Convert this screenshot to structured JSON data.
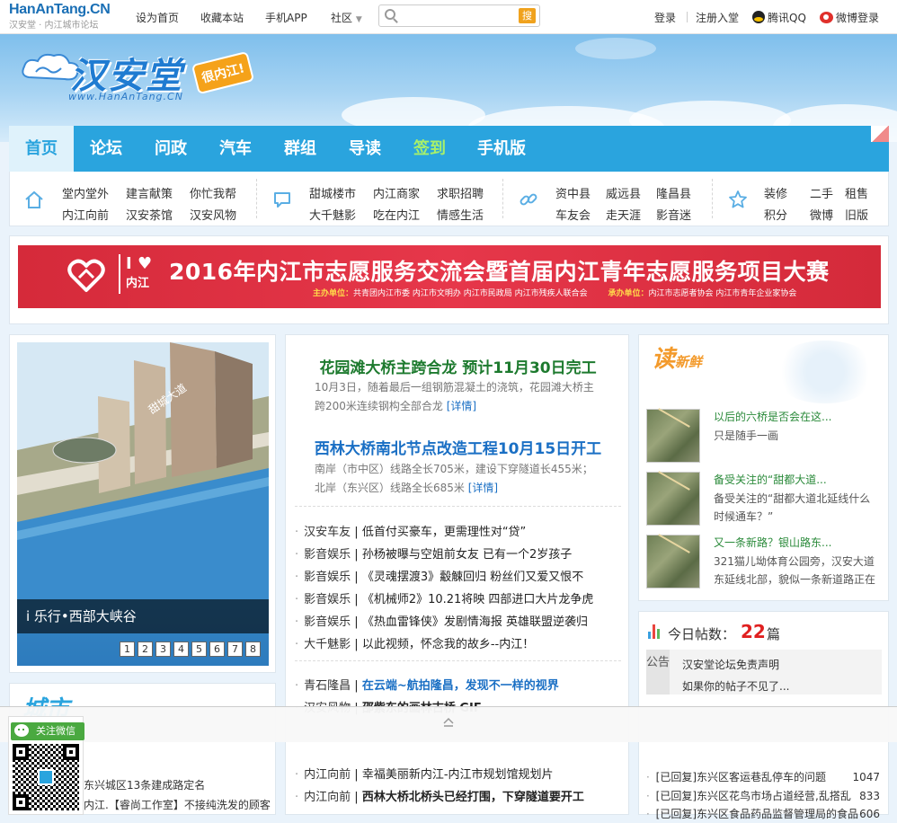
{
  "topbar": {
    "logo_text": "HanAnTang.CN",
    "logo_sub": "汉安堂 · 内江城市论坛",
    "links": [
      "设为首页",
      "收藏本站",
      "手机APP",
      "社区"
    ],
    "search": {
      "placeholder": "",
      "button": "搜"
    },
    "login": "登录",
    "register": "注册入堂",
    "qq": "腾讯QQ",
    "weibo": "微博登录"
  },
  "logo": {
    "name": "汉安堂",
    "slogan": "很内江!",
    "url": "www.HanAnTang.CN"
  },
  "nav": {
    "items": [
      "首页",
      "论坛",
      "问政",
      "汽车",
      "群组",
      "导读",
      "签到",
      "手机版"
    ]
  },
  "subnav": {
    "group1": [
      "堂内堂外",
      "建言献策",
      "你忙我帮",
      "内江向前",
      "汉安茶馆",
      "汉安风物"
    ],
    "group2": [
      "甜城楼市",
      "内江商家",
      "求职招聘",
      "大千魅影",
      "吃在内江",
      "情感生活"
    ],
    "group3": [
      "资中县",
      "威远县",
      "隆昌县",
      "车友会",
      "走天涯",
      "影音迷"
    ],
    "group4": [
      "装修",
      "二手",
      "租售",
      "积分",
      "微博",
      "旧版"
    ]
  },
  "ad": {
    "i_love": "I ♥",
    "city": "内江",
    "title": "2016年内江市志愿服务交流会暨首届内江青年志愿服务项目大赛",
    "host_label": "主办单位：",
    "host": "共青团内江市委  内江市文明办  内江市民政局  内江市残疾人联合会",
    "organizer_label": "承办单位：",
    "organizer": "内江市志愿者协会  内江市青年企业家协会"
  },
  "slider": {
    "caption": "i 乐行•西部大峡谷",
    "pages": [
      "1",
      "2",
      "3",
      "4",
      "5",
      "6",
      "7",
      "8"
    ]
  },
  "headlines": [
    {
      "title": "花园滩大桥主跨合龙 预计11月30日完工",
      "summary": "10月3日，随着最后一组钢筋混凝土的浇筑，花园滩大桥主跨200米连续钢构全部合龙",
      "more": "[详情]"
    },
    {
      "title": "西林大桥南北节点改造工程10月15日开工",
      "summary": "南岸（市中区）线路全长705米，建设下穿隧道长455米；北岸（东兴区）线路全长685米",
      "more": "[详情]"
    }
  ],
  "news1": [
    {
      "cat": "汉安车友",
      "text": "低首付买豪车，更需理性对“贷”"
    },
    {
      "cat": "影音娱乐",
      "text": "孙杨被曝与空姐前女友 已有一个2岁孩子"
    },
    {
      "cat": "影音娱乐",
      "text": "《灵魂摆渡3》觳觫回归 粉丝们又爱又恨不"
    },
    {
      "cat": "影音娱乐",
      "text": "《机械师2》10.21将映 四部进口大片龙争虎"
    },
    {
      "cat": "影音娱乐",
      "text": "《热血雷锋侠》发剧情海报 英雄联盟逆袭归"
    },
    {
      "cat": "大千魅影",
      "text": "以此视频，怀念我的故乡--内江！"
    }
  ],
  "news2": [
    {
      "cat": "青石隆昌",
      "text": "在云端~航拍隆昌，发现不一样的视界"
    },
    {
      "cat": "汉安风物",
      "text": "邵紫东的画林古桥 GIF"
    }
  ],
  "news3": [
    {
      "cat": "内江向前",
      "text": "幸福美丽新内江-内江市规划馆规划片"
    },
    {
      "cat": "内江向前",
      "text": "西林大桥北桥头已经打围，下穿隧道要开工"
    }
  ],
  "readnew": {
    "title": "读",
    "title2": "新鲜",
    "items": [
      {
        "title": "以后的六桥是否会在这...",
        "desc": "只是随手一画"
      },
      {
        "title": "备受关注的“甜都大道...",
        "desc": "备受关注的“甜都大道北延线什么时候通车？”"
      },
      {
        "title": "又一条新路？银山路东...",
        "desc": "321猫儿坳体育公园旁，汉安大道东延线北部，貌似一条新道路正在"
      }
    ]
  },
  "stats": {
    "label": "今日帖数：",
    "count": "22",
    "unit": "篇",
    "notice_tag": "公告",
    "notices": [
      "汉安堂论坛免责声明",
      "如果你的帖子不见了..."
    ],
    "posts": [
      {
        "text": "[已回复]东兴区客运巷乱停车的问题",
        "count": "1047"
      },
      {
        "text": "[已回复]东兴区花鸟市场占道经营,乱搭乱",
        "count": "833"
      },
      {
        "text": "[已回复]东兴区食品药品监督管理局的食品",
        "count": "606"
      }
    ]
  },
  "city": {
    "title": "城市",
    "lines": [
      "东兴城区13条建成路定名",
      "内江.【睿尚工作室】不接纯洗发的顾客"
    ]
  },
  "wechat": {
    "button": "关注微信"
  }
}
